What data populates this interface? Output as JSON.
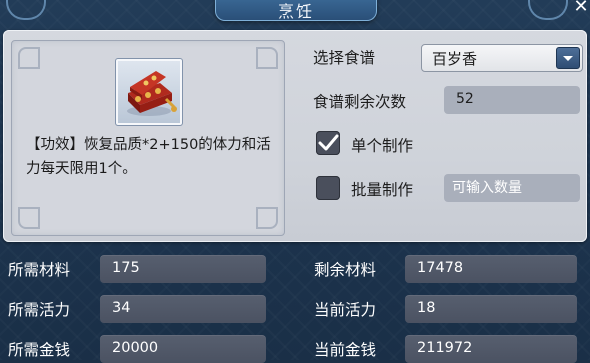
{
  "window": {
    "title": "烹饪",
    "close_glyph": "✕"
  },
  "item": {
    "icon": "treasure-chest-dish-icon",
    "description": "【功效】恢复品质*2+150的体力和活力每天限用1个。"
  },
  "recipe": {
    "select_label": "选择食谱",
    "selected": "百岁香",
    "remaining_label": "食谱剩余次数",
    "remaining_value": "52"
  },
  "mode": {
    "single_label": "单个制作",
    "single_checked": true,
    "batch_label": "批量制作",
    "batch_checked": false,
    "batch_placeholder": "可输入数量"
  },
  "stats": {
    "materials_needed_label": "所需材料",
    "materials_needed": "175",
    "materials_left_label": "剩余材料",
    "materials_left": "17478",
    "vigor_needed_label": "所需活力",
    "vigor_needed": "34",
    "vigor_current_label": "当前活力",
    "vigor_current": "18",
    "money_needed_label": "所需金钱",
    "money_needed": "20000",
    "money_current_label": "当前金钱",
    "money_current": "211972"
  },
  "colors": {
    "accent": "#3c4250",
    "panel": "#d5d8df",
    "window": "#1d3550"
  }
}
